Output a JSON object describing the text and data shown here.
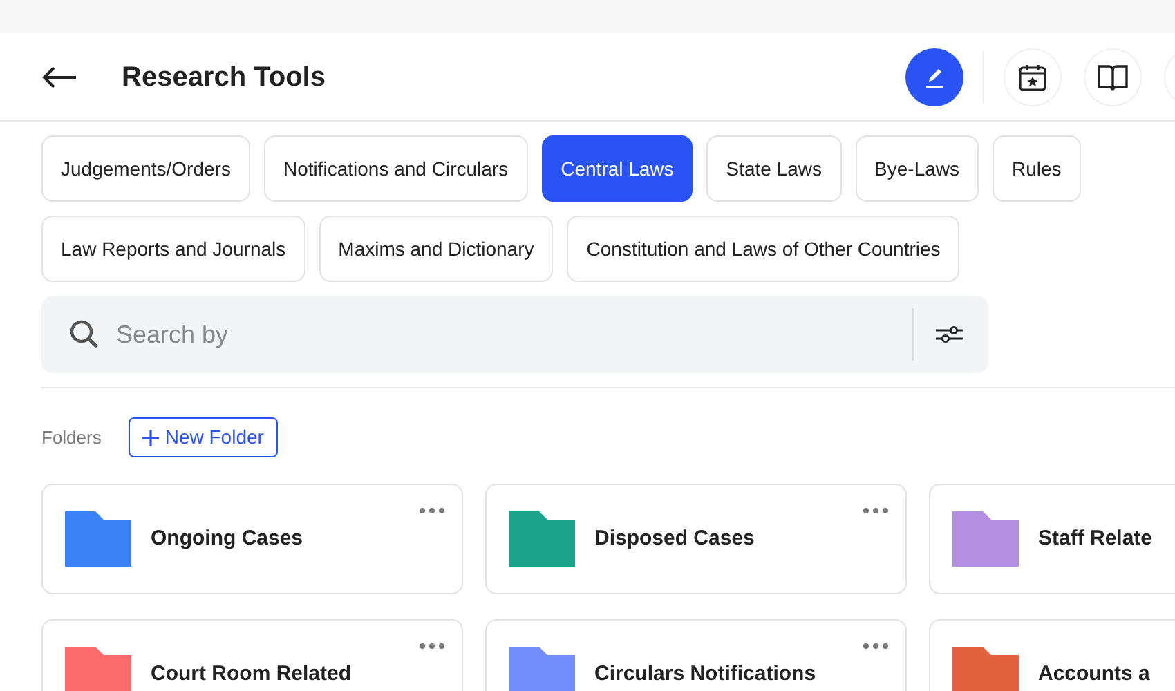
{
  "header": {
    "title": "Research Tools"
  },
  "filter_rows": [
    [
      {
        "label": "Judgements/Orders",
        "selected": false
      },
      {
        "label": "Notifications and Circulars",
        "selected": false
      },
      {
        "label": "Central Laws",
        "selected": true
      },
      {
        "label": "State Laws",
        "selected": false
      },
      {
        "label": "Bye-Laws",
        "selected": false
      },
      {
        "label": "Rules",
        "selected": false
      }
    ],
    [
      {
        "label": "Law Reports and Journals",
        "selected": false
      },
      {
        "label": "Maxims and Dictionary",
        "selected": false
      },
      {
        "label": "Constitution and Laws of Other Countries",
        "selected": false
      }
    ]
  ],
  "search": {
    "placeholder": "Search by"
  },
  "folders_section": {
    "label": "Folders",
    "new_folder_button": "New Folder"
  },
  "folders": [
    {
      "name": "Ongoing Cases",
      "color": "#3b82f6"
    },
    {
      "name": "Disposed Cases",
      "color": "#1aa58a"
    },
    {
      "name": "Staff Relate",
      "color": "#b48ee0"
    },
    {
      "name": "Court Room Related",
      "color": "#fb6b6b"
    },
    {
      "name": "Circulars Notifications",
      "color": "#738dfb"
    },
    {
      "name": "Accounts a",
      "color": "#e2623e"
    }
  ]
}
